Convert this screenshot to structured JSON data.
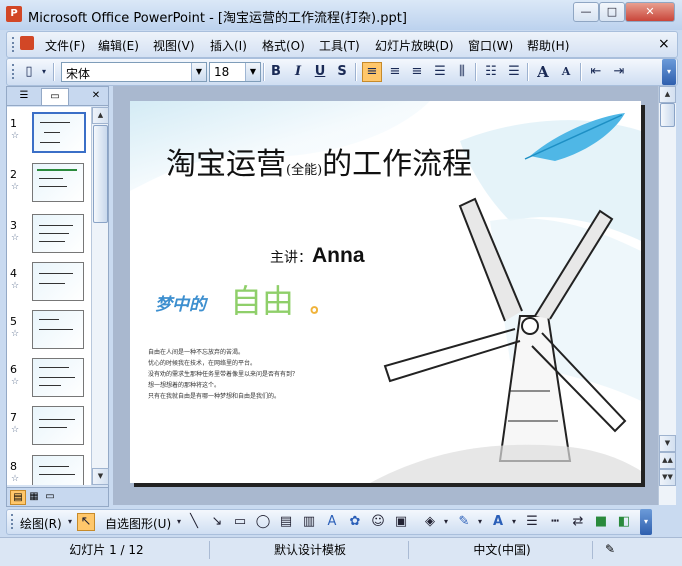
{
  "window": {
    "title": "Microsoft Office PowerPoint - [淘宝运营的工作流程(打杂).ppt]",
    "app_icon": "P",
    "buttons": {
      "minimize": "—",
      "maximize": "□",
      "close": "✕"
    }
  },
  "menu": {
    "items": [
      "文件(F)",
      "编辑(E)",
      "视图(V)",
      "插入(I)",
      "格式(O)",
      "工具(T)",
      "幻灯片放映(D)",
      "窗口(W)",
      "帮助(H)"
    ],
    "close": "×"
  },
  "toolbar": {
    "font_name": "宋体",
    "font_size": "18",
    "bold": "B",
    "italic": "I",
    "underline": "U",
    "shadow": "S",
    "grow_font": "A",
    "shrink_font": "A"
  },
  "left_pane": {
    "tabs": {
      "outline": "☰",
      "slides": "▭",
      "close": "✕"
    },
    "thumbnails": [
      {
        "num": "1"
      },
      {
        "num": "2"
      },
      {
        "num": "3"
      },
      {
        "num": "4"
      },
      {
        "num": "5"
      },
      {
        "num": "6"
      },
      {
        "num": "7"
      },
      {
        "num": "8"
      }
    ],
    "star": "☆"
  },
  "slide": {
    "title_main_a": "淘宝运营",
    "title_small": "(全能)",
    "title_main_b": "的工作流程",
    "presenter_label": "主讲：",
    "presenter_name": "Anna",
    "dream_a": "梦中的",
    "dream_b": "自由",
    "dream_c": "。",
    "body_lines": [
      "自由在人间是一种不忘放弃的苦渴。",
      "忧心的时候我在技术，在网络里的平台。",
      "没有劝的需求生那种任务里带着像里以来问是否有有到？",
      "想一想想着的那种将这个。",
      "只有在我就自由是有哪一种梦想和自由是我们的。"
    ]
  },
  "drawbar": {
    "draw_label": "绘图(R)",
    "autoshape_label": "自选图形(U)"
  },
  "status": {
    "slide_info": "幻灯片 1 / 12",
    "template": "默认设计模板",
    "language": "中文(中国)"
  }
}
